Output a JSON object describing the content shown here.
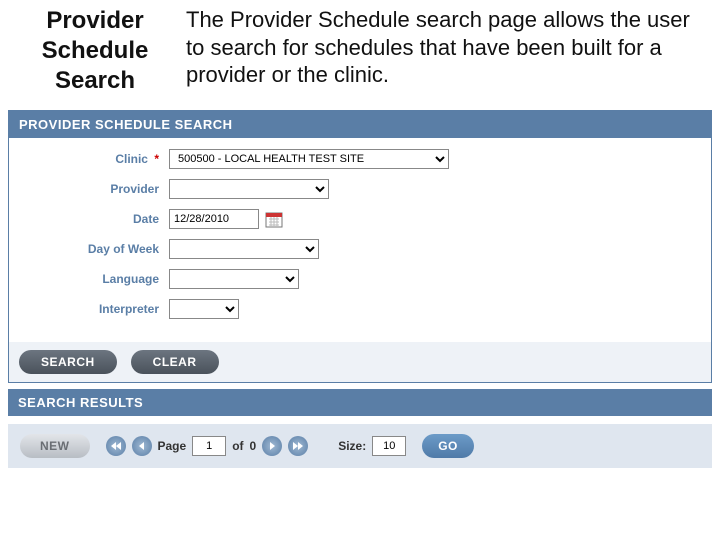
{
  "header": {
    "title": "Provider Schedule Search",
    "description": "The Provider Schedule search page allows the user to search for schedules that have been built for a provider or the clinic."
  },
  "panel": {
    "title": "PROVIDER SCHEDULE SEARCH"
  },
  "form": {
    "clinic": {
      "label": "Clinic",
      "required": "*",
      "value": "500500 - LOCAL HEALTH TEST SITE"
    },
    "provider": {
      "label": "Provider",
      "value": ""
    },
    "date": {
      "label": "Date",
      "value": "12/28/2010"
    },
    "day_of_week": {
      "label": "Day of Week",
      "value": ""
    },
    "language": {
      "label": "Language",
      "value": ""
    },
    "interpreter": {
      "label": "Interpreter",
      "value": ""
    }
  },
  "buttons": {
    "search": "SEARCH",
    "clear": "CLEAR"
  },
  "results": {
    "title": "SEARCH RESULTS"
  },
  "pager": {
    "new": "NEW",
    "page_label": "Page",
    "page_value": "1",
    "of_label": "of",
    "total": "0",
    "size_label": "Size:",
    "size_value": "10",
    "go": "GO"
  }
}
